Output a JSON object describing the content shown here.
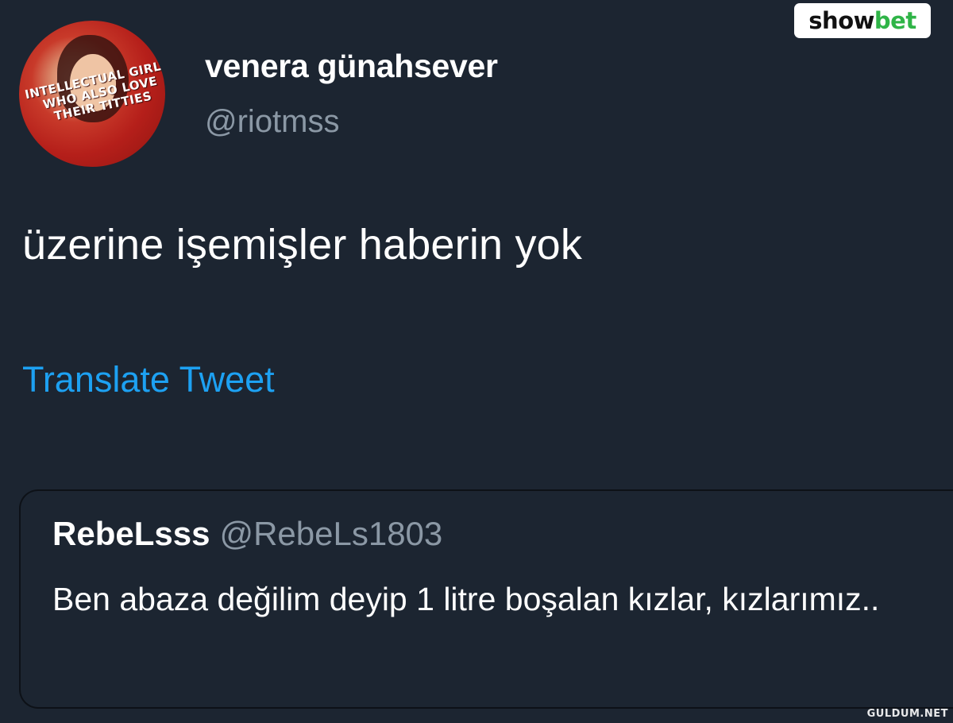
{
  "author": {
    "display_name": "venera günahsever",
    "handle": "@riotmss",
    "avatar_caption": "INTELLECTUAL GIRLS WHO ALSO LOVE THEIR TITTIES"
  },
  "tweet": {
    "text": "üzerine işemişler haberin yok",
    "translate_label": "Translate Tweet"
  },
  "quoted_tweet": {
    "display_name": "RebeLsss",
    "handle": "@RebeLs1803",
    "text": "Ben abaza değilim deyip 1 litre boşalan kızlar, kızlarımız.."
  },
  "branding": {
    "badge_part1": "show",
    "badge_part2": "bet",
    "watermark": "GULDUM.NET",
    "accent_color": "#1da1f2",
    "brand_green": "#2fb447"
  }
}
